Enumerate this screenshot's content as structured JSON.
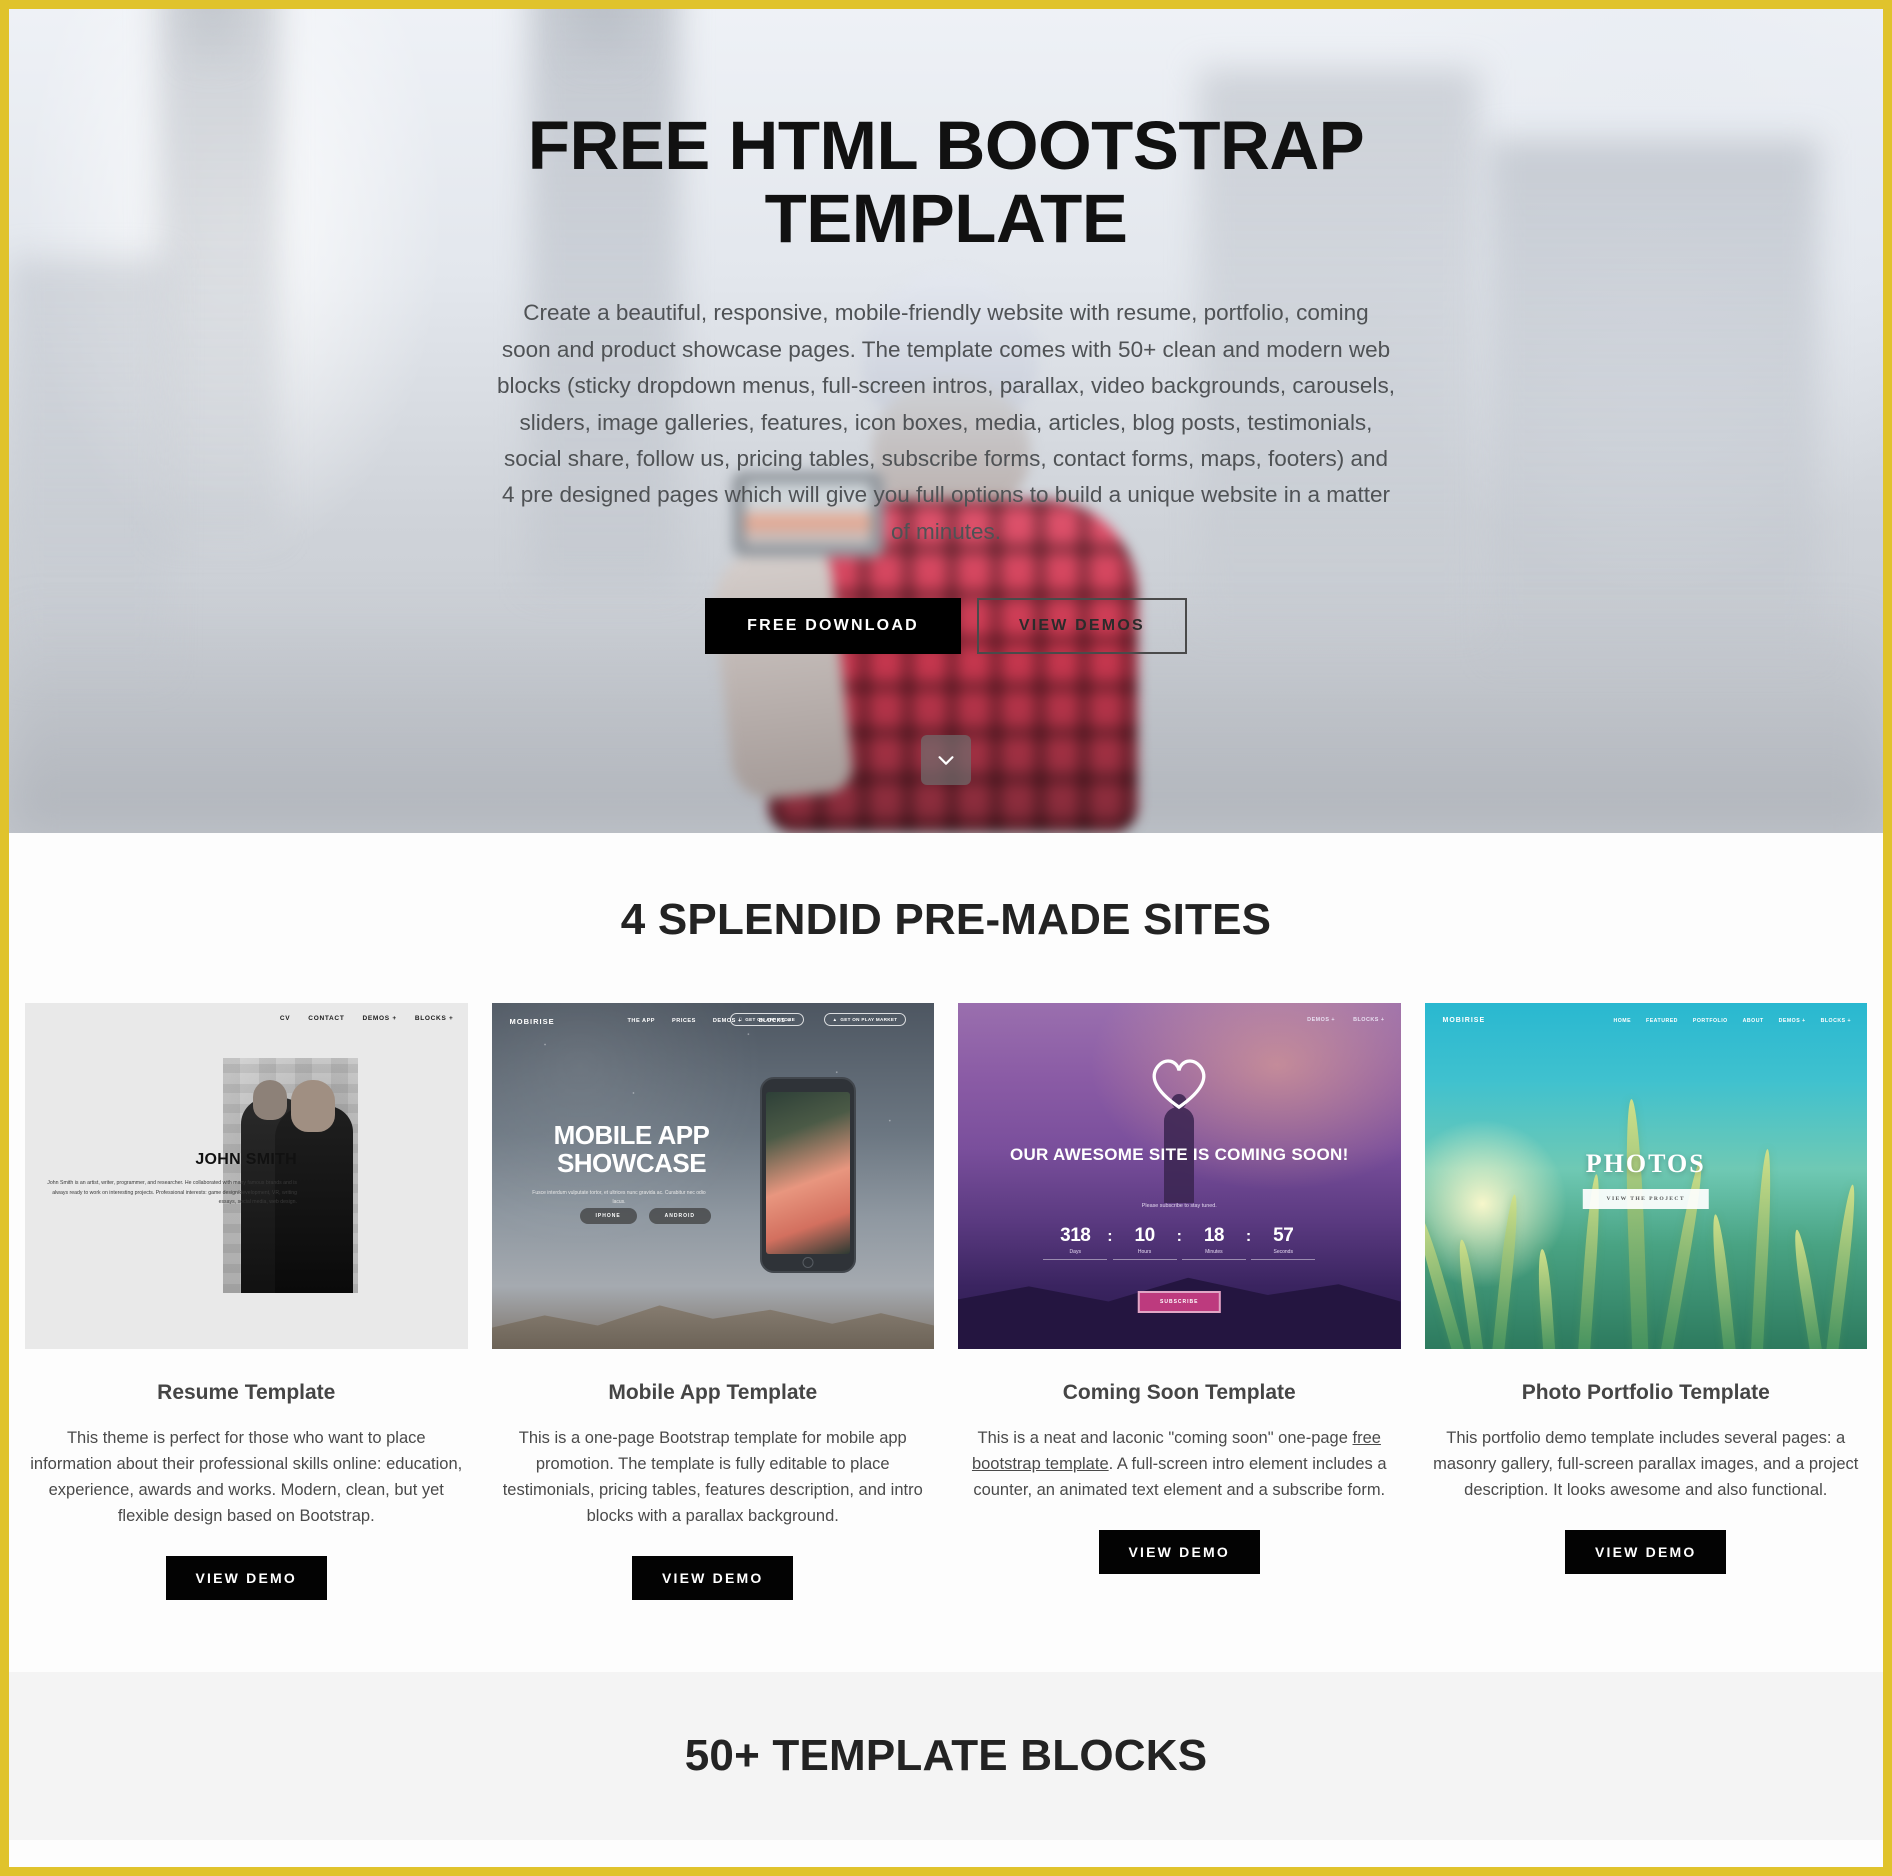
{
  "theme": {
    "border_color": "#e0c32c",
    "accent_dark": "#000000",
    "section_bg": "#f4f4f4"
  },
  "hero": {
    "title": "FREE HTML BOOTSTRAP TEMPLATE",
    "paragraph": "Create a beautiful, responsive, mobile-friendly website with resume, portfolio, coming soon and product showcase pages. The template comes with 50+ clean and modern web blocks (sticky dropdown menus, full-screen intros, parallax, video backgrounds, carousels, sliders, image galleries, features, icon boxes, media, articles, blog posts, testimonials, social share, follow us, pricing tables, subscribe forms, contact forms, maps, footers) and 4 pre designed pages which will give you full options to build a unique website in a matter of minutes.",
    "primary_button": "FREE DOWNLOAD",
    "secondary_button": "VIEW DEMOS",
    "scroll_icon": "chevron-down-icon"
  },
  "sites": {
    "title": "4 SPLENDID PRE-MADE SITES",
    "cards": [
      {
        "title": "Resume Template",
        "description": "This theme is perfect for those who want to place information about their professional skills online: education, experience, awards and works. Modern, clean, but yet flexible design based on Bootstrap.",
        "button": "VIEW DEMO",
        "thumb": {
          "nav": [
            "CV",
            "CONTACT",
            "DEMOS +",
            "BLOCKS +"
          ],
          "name": "JOHN SMITH",
          "bio": "John Smith is an artist, writer, programmer, and researcher. He collaborated with many famous brands and is always ready to work on interesting projects. Professional interests: game design/development, VR, writing essays, social media, web design."
        }
      },
      {
        "title": "Mobile App Template",
        "description": "This is a one-page Bootstrap template for mobile app promotion. The template is fully editable to place testimonials, pricing tables, features description, and intro blocks with a parallax background.",
        "button": "VIEW DEMO",
        "thumb": {
          "logo": "MOBIRISE",
          "nav": [
            "THE APP",
            "PRICES",
            "DEMOS +",
            "BLOCKS +"
          ],
          "store_buttons": [
            "GET ON APP STORE",
            "GET ON PLAY MARKET"
          ],
          "heading": "MOBILE APP SHOWCASE",
          "subtext": "Fusce interdum vulputate tortor, et ultrices nunc gravida ac. Curabitur nec odio lacus.",
          "pills": [
            "IPHONE",
            "ANDROID"
          ]
        }
      },
      {
        "title": "Coming Soon Template",
        "description_pre": "This is a neat and laconic \"coming soon\" one-page ",
        "description_link": "free bootstrap template",
        "description_post": ". A full-screen intro element includes a counter, an animated text element and a subscribe form.",
        "button": "VIEW DEMO",
        "thumb": {
          "nav": [
            "DEMOS +",
            "BLOCKS +"
          ],
          "icon": "heart-icon",
          "heading": "OUR AWESOME SITE IS COMING SOON!",
          "subtext": "Please subscribe to stay tuned.",
          "counter": [
            {
              "value": "318",
              "label": "Days"
            },
            {
              "value": "10",
              "label": "Hours"
            },
            {
              "value": "18",
              "label": "Minutes"
            },
            {
              "value": "57",
              "label": "Seconds"
            }
          ],
          "subscribe_button": "SUBSCRIBE"
        }
      },
      {
        "title": "Photo Portfolio Template",
        "description": "This portfolio demo template includes several pages: a masonry gallery, full-screen parallax images, and a project description. It looks awesome and also functional.",
        "button": "VIEW DEMO",
        "thumb": {
          "logo": "MOBIRISE",
          "nav": [
            "HOME",
            "FEATURED",
            "PORTFOLIO",
            "ABOUT",
            "DEMOS +",
            "BLOCKS +"
          ],
          "heading": "PHOTOS",
          "cta": "VIEW THE PROJECT"
        }
      }
    ]
  },
  "blocks": {
    "title": "50+ TEMPLATE BLOCKS"
  }
}
